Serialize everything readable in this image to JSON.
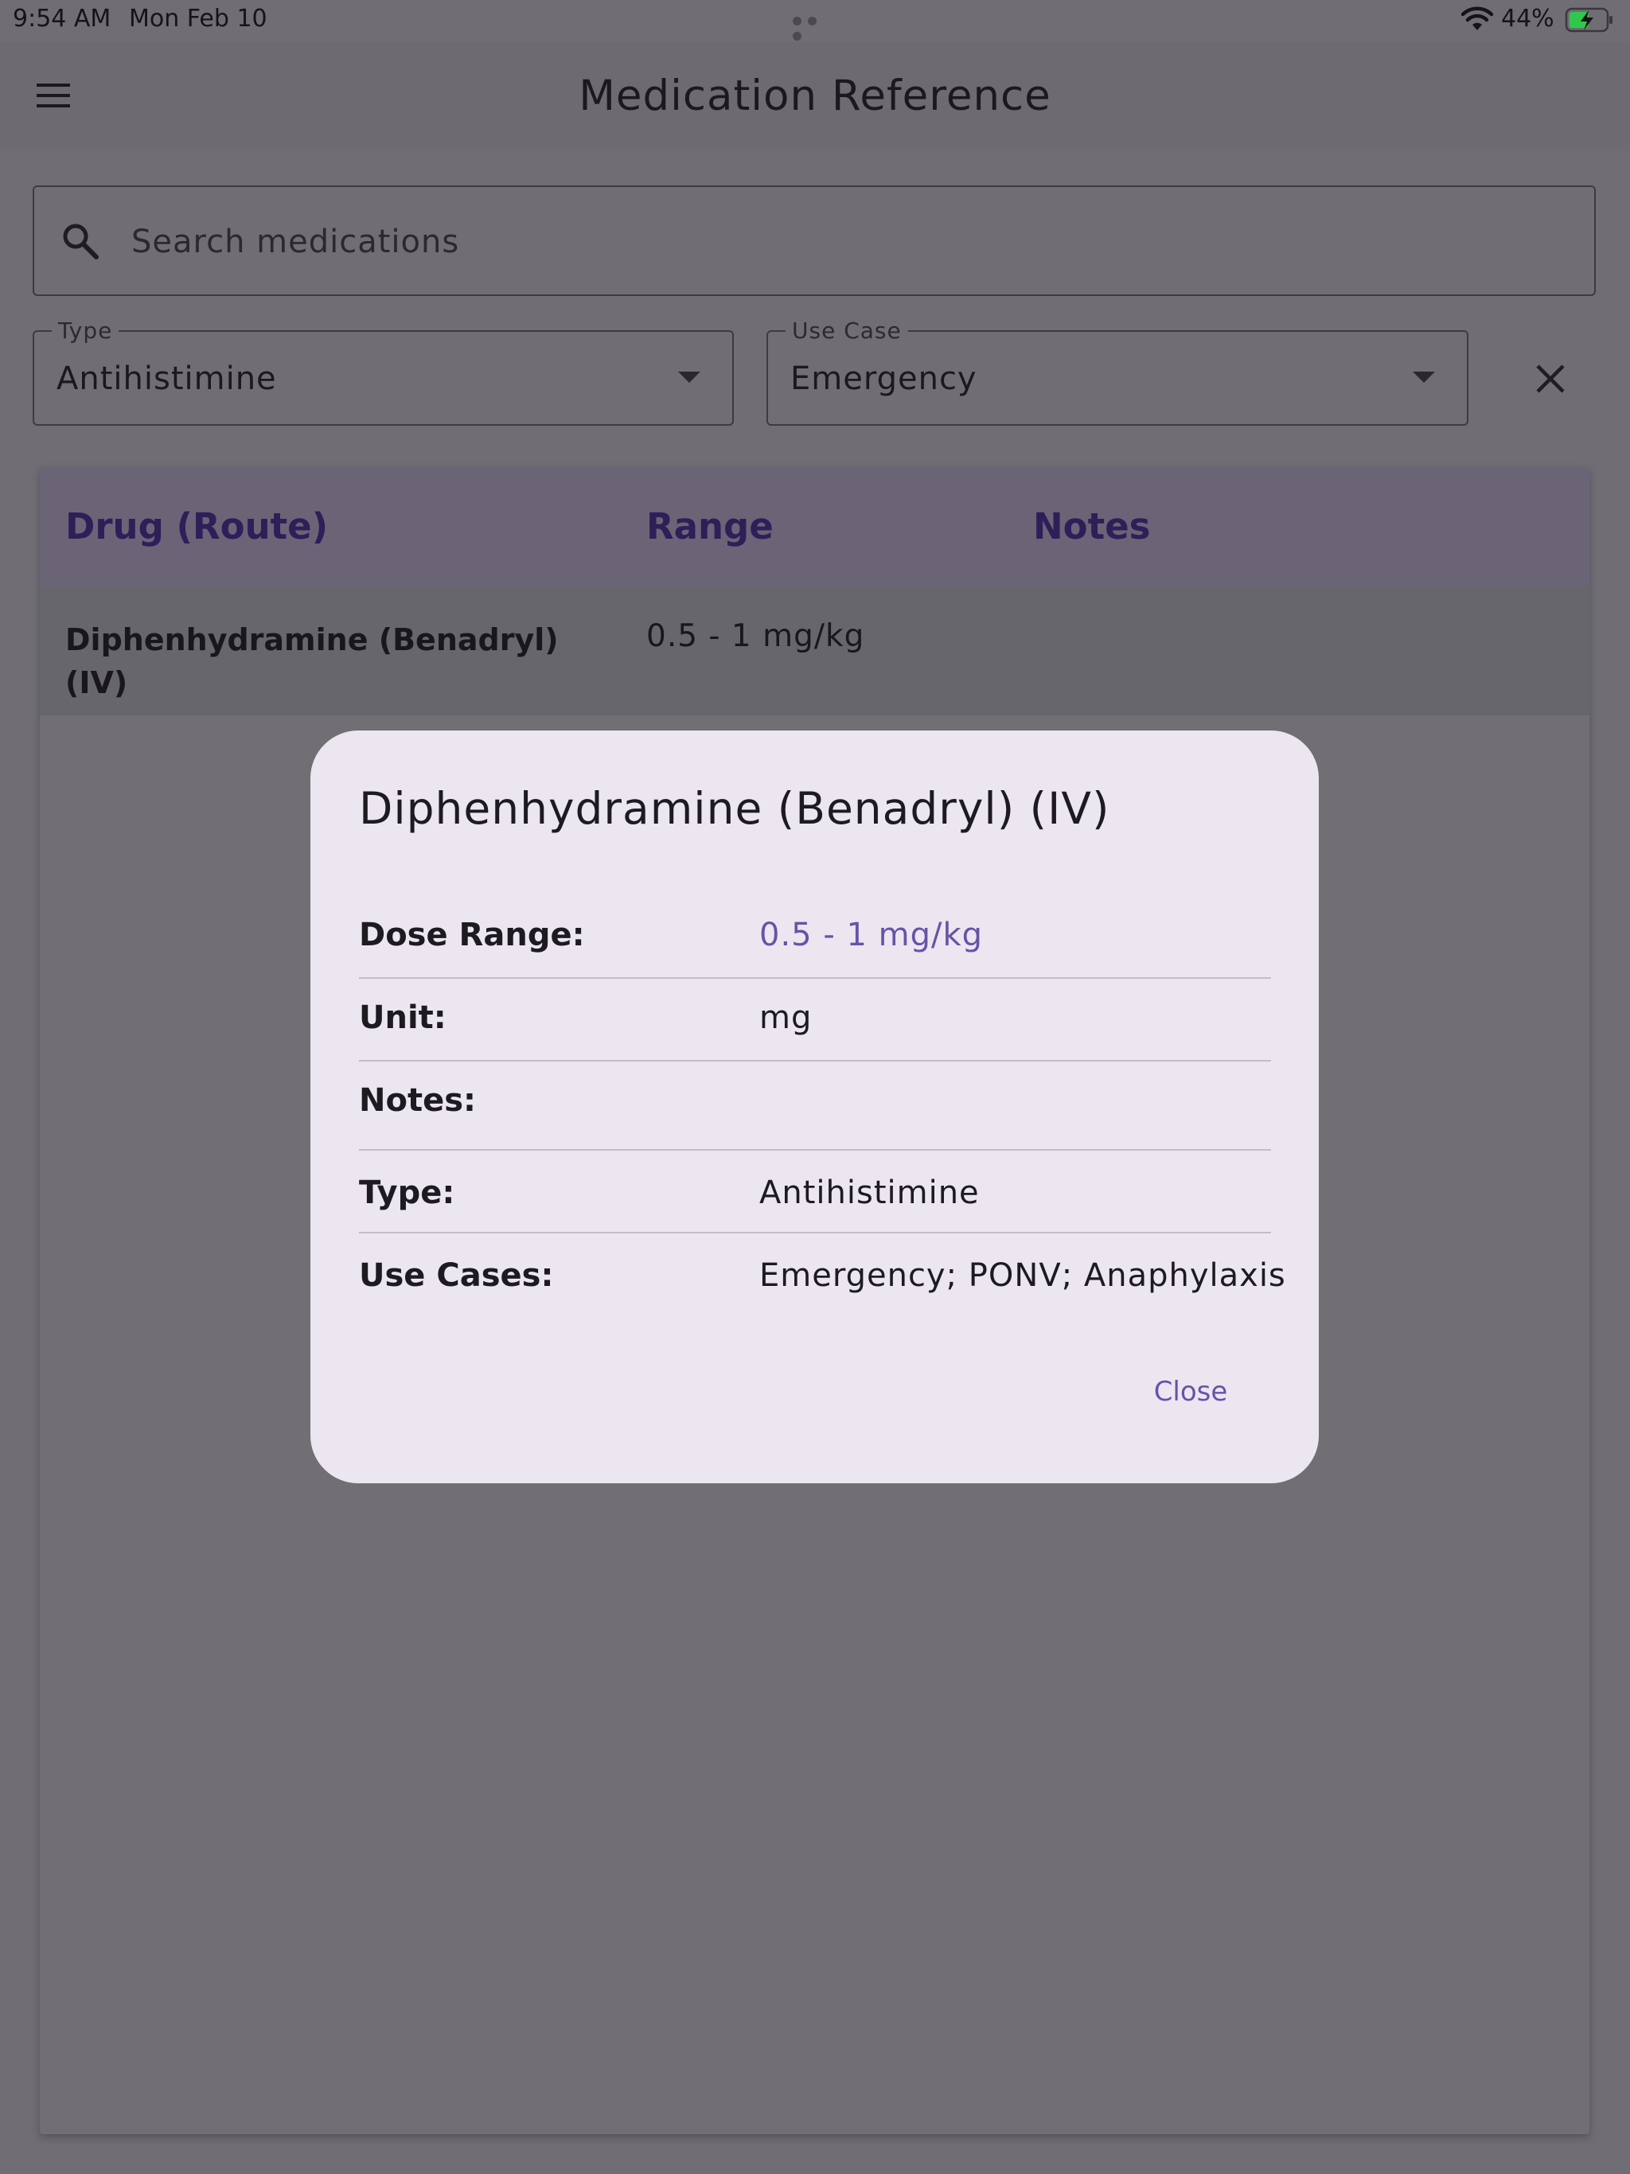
{
  "status_bar": {
    "time": "9:54 AM",
    "date": "Mon Feb 10",
    "battery": "44%"
  },
  "app_bar": {
    "title": "Medication Reference",
    "menu_icon": "menu-icon"
  },
  "search": {
    "placeholder": "Search medications",
    "value": "",
    "icon": "search-icon"
  },
  "filters": {
    "type": {
      "label": "Type",
      "value": "Antihistimine"
    },
    "use_case": {
      "label": "Use Case",
      "value": "Emergency"
    },
    "clear_icon": "close-icon"
  },
  "table": {
    "columns": [
      "Drug (Route)",
      "Range",
      "Notes"
    ],
    "rows": [
      {
        "drug_route": "Diphenhydramine (Benadryl) (IV)",
        "range": "0.5 - 1 mg/kg",
        "notes": ""
      }
    ]
  },
  "dialog": {
    "title": "Diphenhydramine (Benadryl) (IV)",
    "fields": [
      {
        "label": "Dose Range:",
        "value": "0.5 - 1 mg/kg"
      },
      {
        "label": "Unit:",
        "value": "mg"
      },
      {
        "label": "Notes:",
        "value": ""
      },
      {
        "label": "Type:",
        "value": "Antihistimine"
      },
      {
        "label": "Use Cases:",
        "value": "Emergency; PONV; Anaphylaxis"
      }
    ],
    "close_label": "Close"
  },
  "colors": {
    "accent": "#6554a8",
    "scrim_background": "#706e74",
    "dialog_background": "#ece6f0",
    "table_header": "#6b6477",
    "table_header_text": "#2d1f58"
  }
}
